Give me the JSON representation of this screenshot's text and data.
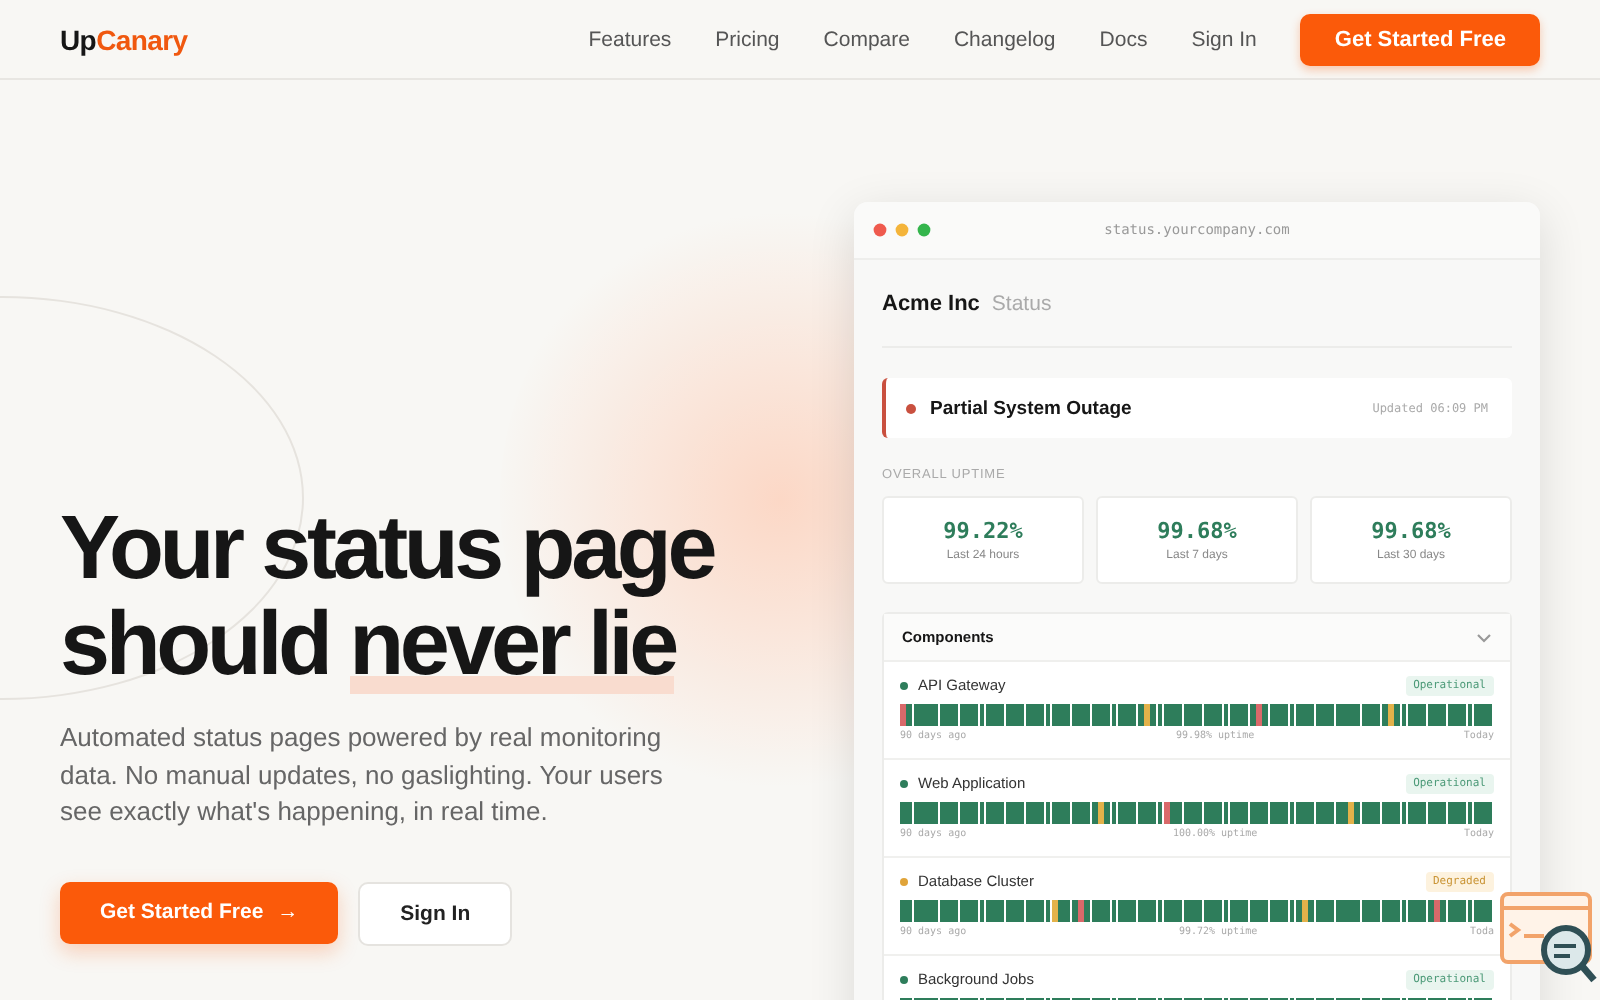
{
  "nav": {
    "logo": {
      "text": "Up",
      "accent_text": "Canary"
    },
    "links": [
      "Features",
      "Pricing",
      "Compare",
      "Changelog",
      "Docs",
      "Sign In"
    ],
    "cta": "Get Started Free"
  },
  "hero": {
    "headline": {
      "text": "Your status page should ",
      "highlighted": "never lie"
    },
    "subtitle": "Automated status pages powered by real monitoring data. No manual updates, no gaslighting. Your users see exactly what's happening, in real time.",
    "primary": {
      "label": "Get Started Free",
      "arrow": "→"
    },
    "secondary": "Sign In"
  },
  "mockup": {
    "url": "status.yourcompany.com",
    "company": "Acme Inc",
    "company_suffix": "Status",
    "banner": {
      "title": "Partial System Outage",
      "updated": "Updated 06:09 PM",
      "color": "#c9503f"
    },
    "uptime_label": "OVERALL UPTIME",
    "stats": [
      {
        "value": "99.22%",
        "label": "Last 24 hours"
      },
      {
        "value": "99.68%",
        "label": "Last 7 days"
      },
      {
        "value": "99.68%",
        "label": "Last 30 days"
      }
    ],
    "components_title": "Components",
    "expanded": true,
    "components": [
      {
        "name": "API Gateway",
        "color": "#2e7d5b",
        "kind": "operational",
        "badge": "Operational",
        "left": "90 days ago",
        "uptime": "99.98% uptime",
        "right": "Today"
      },
      {
        "name": "Web Application",
        "color": "#2e7d5b",
        "kind": "operational",
        "badge": "Operational",
        "left": "90 days ago",
        "uptime": "100.00% uptime",
        "right": "Today"
      },
      {
        "name": "Database Cluster",
        "color": "#e0a43a",
        "kind": "degraded",
        "badge": "Degraded",
        "left": "90 days ago",
        "uptime": "99.72% uptime",
        "right": "Toda"
      },
      {
        "name": "Background Jobs",
        "color": "#2e7d5b",
        "kind": "operational",
        "badge": "Operational"
      }
    ]
  }
}
